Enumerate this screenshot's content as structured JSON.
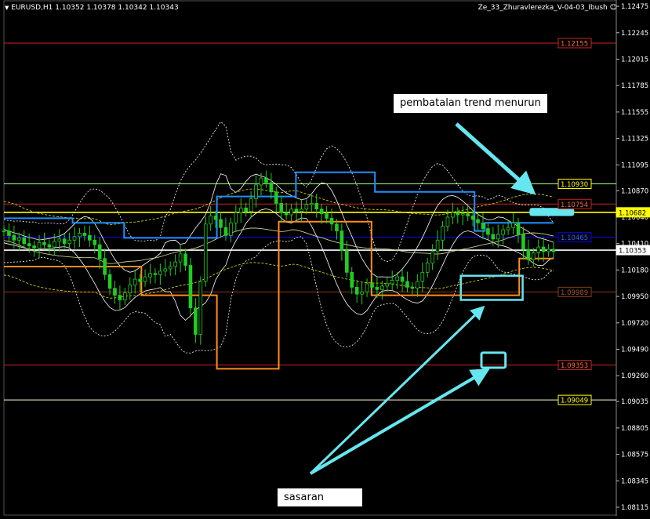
{
  "header": {
    "symbol_line": "EURUSD,H1  1.10352 1.10378 1.10342 1.10343",
    "indicator_name": "Ze_33_Zhuravlerezka_V-04-03_Ibush",
    "smiley": "☺"
  },
  "annotations": {
    "reversal_text": "pembatalan trend menurun",
    "target_text": "sasaran"
  },
  "colors": {
    "background": "#000000",
    "candles": "#22cc22",
    "cyan_box": "#66e6ee",
    "blue_step": "#1e90ff",
    "orange_step": "#ff8c1a",
    "red_level": "#cc2222",
    "yellow_level": "#ffff00"
  },
  "chart_data": {
    "type": "line",
    "symbol": "EURUSD",
    "timeframe": "H1",
    "ohlc_last": {
      "open": 1.10352,
      "high": 1.10378,
      "low": 1.10342,
      "close": 1.10343
    },
    "y_axis": {
      "ylim": [
        1.0804,
        1.1253
      ],
      "ticks": [
        "1.12475",
        "1.12245",
        "1.12015",
        "1.11785",
        "1.11555",
        "1.11325",
        "1.11095",
        "1.10870",
        "1.10640",
        "1.10410",
        "1.10180",
        "1.09950",
        "1.09720",
        "1.09490",
        "1.09260",
        "1.09035",
        "1.08805",
        "1.08575",
        "1.08345",
        "1.08115"
      ]
    },
    "x_range": [
      0,
      160
    ],
    "levels": [
      {
        "label": "1.12155",
        "value": 1.12155,
        "color": "#cc2222",
        "label_border": "#cc2222",
        "label_text": "#ff6644"
      },
      {
        "label": "1.10930",
        "value": 1.1093,
        "color": "#aaff88",
        "label_border": "#ffff00",
        "label_text": "#ffff00"
      },
      {
        "label": "1.10754",
        "value": 1.10754,
        "color": "#cc2222",
        "label_border": "#cc2222",
        "label_text": "#ff6644"
      },
      {
        "label": "1.10682",
        "value": 1.10682,
        "color": "#ffff00",
        "label_border": "#ffff00",
        "label_text": "#000000",
        "filled": true
      },
      {
        "label": "1.10465",
        "value": 1.10465,
        "color": "#0000ff",
        "label_border": "#0000ff",
        "label_text": "#3366ff"
      },
      {
        "label": "1.10353",
        "value": 1.10353,
        "color": "#ffffff",
        "label_border": "#ffffff",
        "label_text": "#000000",
        "filled": true
      },
      {
        "label": "1.09989",
        "value": 1.09989,
        "color": "#8b3a1a",
        "label_border": "#8b3a1a",
        "label_text": "#aa5522"
      },
      {
        "label": "1.09353",
        "value": 1.09353,
        "color": "#cc2222",
        "label_border": "#cc2222",
        "label_text": "#ff6644"
      },
      {
        "label": "1.09049",
        "value": 1.09049,
        "color": "#ffffcc",
        "label_border": "#ffff00",
        "label_text": "#ffff00"
      }
    ],
    "close_series": [
      1.1052,
      1.1048,
      1.1044,
      1.1046,
      1.1041,
      1.1039,
      1.1037,
      1.1042,
      1.104,
      1.1038,
      1.1043,
      1.1045,
      1.1041,
      1.1044,
      1.1047,
      1.105,
      1.1048,
      1.1044,
      1.104,
      1.1028,
      1.1014,
      1.1002,
      1.0996,
      1.0992,
      1.0998,
      1.1005,
      1.101,
      1.1008,
      1.1012,
      1.1015,
      1.1014,
      1.1017,
      1.1019,
      1.1021,
      1.1025,
      1.1032,
      1.1022,
      1.0985,
      1.0962,
      1.1008,
      1.1058,
      1.1065,
      1.1062,
      1.1055,
      1.1048,
      1.1059,
      1.1068,
      1.1072,
      1.1069,
      1.108,
      1.1092,
      1.1098,
      1.1094,
      1.1086,
      1.1076,
      1.1068,
      1.1066,
      1.1071,
      1.1069,
      1.1071,
      1.1075,
      1.1076,
      1.1071,
      1.1067,
      1.1063,
      1.1058,
      1.1052,
      1.1035,
      1.1016,
      1.1003,
      1.0997,
      1.0999,
      1.1006,
      1.1003,
      1.1001,
      1.1004,
      1.1006,
      1.1009,
      1.1012,
      1.1008,
      1.1003,
      1.1002,
      1.1008,
      1.1016,
      1.1024,
      1.1034,
      1.1044,
      1.1056,
      1.1064,
      1.1068,
      1.1066,
      1.1067,
      1.1065,
      1.1062,
      1.1059,
      1.1054,
      1.1049,
      1.1045,
      1.1049,
      1.1053,
      1.1055,
      1.1059,
      1.1049,
      1.1036,
      1.1027,
      1.1033,
      1.1038,
      1.1034,
      1.1036,
      1.1034
    ],
    "blue_step": [
      [
        0,
        1.1063
      ],
      [
        20,
        1.1063
      ],
      [
        20,
        1.1059
      ],
      [
        35,
        1.1059
      ],
      [
        35,
        1.1046
      ],
      [
        62,
        1.1046
      ],
      [
        62,
        1.1082
      ],
      [
        85,
        1.1082
      ],
      [
        85,
        1.1103
      ],
      [
        108,
        1.1103
      ],
      [
        108,
        1.1086
      ],
      [
        137,
        1.1086
      ],
      [
        137,
        1.1052
      ],
      [
        140,
        1.1052
      ],
      [
        140,
        1.1059
      ],
      [
        160,
        1.1059
      ]
    ],
    "orange_step": [
      [
        0,
        1.1021
      ],
      [
        40,
        1.1021
      ],
      [
        40,
        1.0996
      ],
      [
        62,
        1.0996
      ],
      [
        62,
        1.0932
      ],
      [
        80,
        1.0932
      ],
      [
        80,
        1.106
      ],
      [
        107,
        1.106
      ],
      [
        107,
        1.0996
      ],
      [
        150,
        1.0996
      ],
      [
        150,
        1.1028
      ],
      [
        160,
        1.1028
      ]
    ],
    "target_zone": {
      "x_range": [
        133,
        151
      ],
      "value_range": [
        1.0992,
        1.1013
      ]
    },
    "reversal_marker": {
      "x_range": [
        153,
        166
      ],
      "value_range": [
        1.1065,
        1.1072
      ]
    },
    "target_marker": {
      "x_range": [
        139,
        146
      ],
      "value_range": [
        1.0933,
        1.0946
      ]
    }
  }
}
